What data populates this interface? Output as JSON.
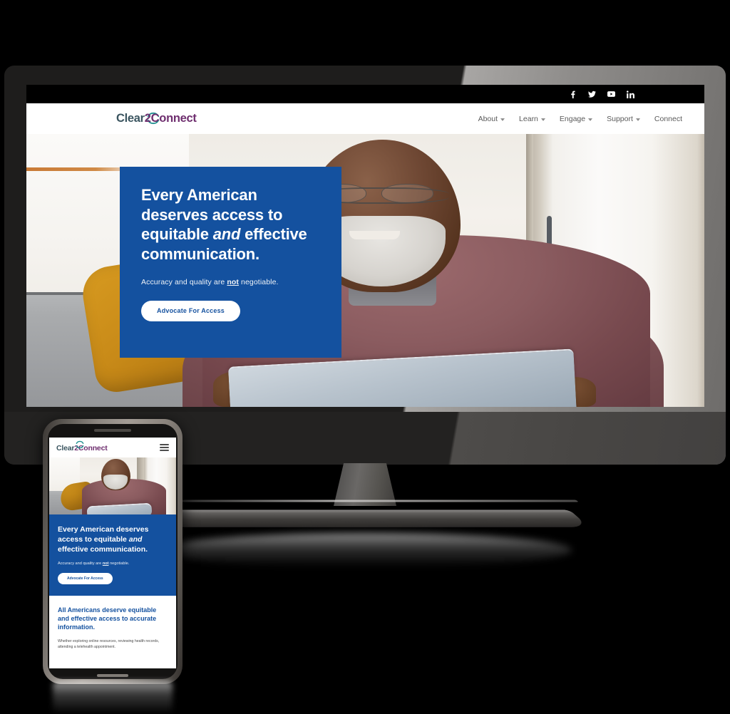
{
  "site": {
    "social": [
      {
        "name": "facebook",
        "glyph": "f"
      },
      {
        "name": "twitter",
        "glyph": "t"
      },
      {
        "name": "youtube",
        "glyph": "y"
      },
      {
        "name": "linkedin",
        "glyph": "in"
      }
    ],
    "logo": {
      "part1": "Clear",
      "part2": "2",
      "part3": "Connect",
      "color_teal": "#3b5560",
      "color_purple": "#6f2f6f",
      "ring_color": "#1f8f8f"
    },
    "nav": [
      {
        "label": "About",
        "has_dropdown": true
      },
      {
        "label": "Learn",
        "has_dropdown": true
      },
      {
        "label": "Engage",
        "has_dropdown": true
      },
      {
        "label": "Support",
        "has_dropdown": true
      },
      {
        "label": "Connect",
        "has_dropdown": false
      }
    ],
    "hero": {
      "title_line1": "Every American",
      "title_line2": "deserves access to",
      "title_line3_a": "equitable ",
      "title_line3_em": "and",
      "title_line3_b": " effective",
      "title_line4": "communication.",
      "sub_a": "Accuracy and quality are ",
      "sub_u": "not",
      "sub_b": " negotiable.",
      "button": "Advocate For Access",
      "panel_color": "#14519f"
    }
  },
  "mobile": {
    "hero": {
      "title_a": "Every American deserves access to equitable ",
      "title_em": "and",
      "title_b": " effective communication.",
      "sub_a": "Accuracy and quality are ",
      "sub_u": "not",
      "sub_b": " negotiable.",
      "button": "Advocate For Access"
    },
    "section": {
      "heading": "All Americans deserve equitable and effective access to accurate information.",
      "body": "Whether exploring online resources, reviewing health records, attending a telehealth appointment."
    }
  }
}
